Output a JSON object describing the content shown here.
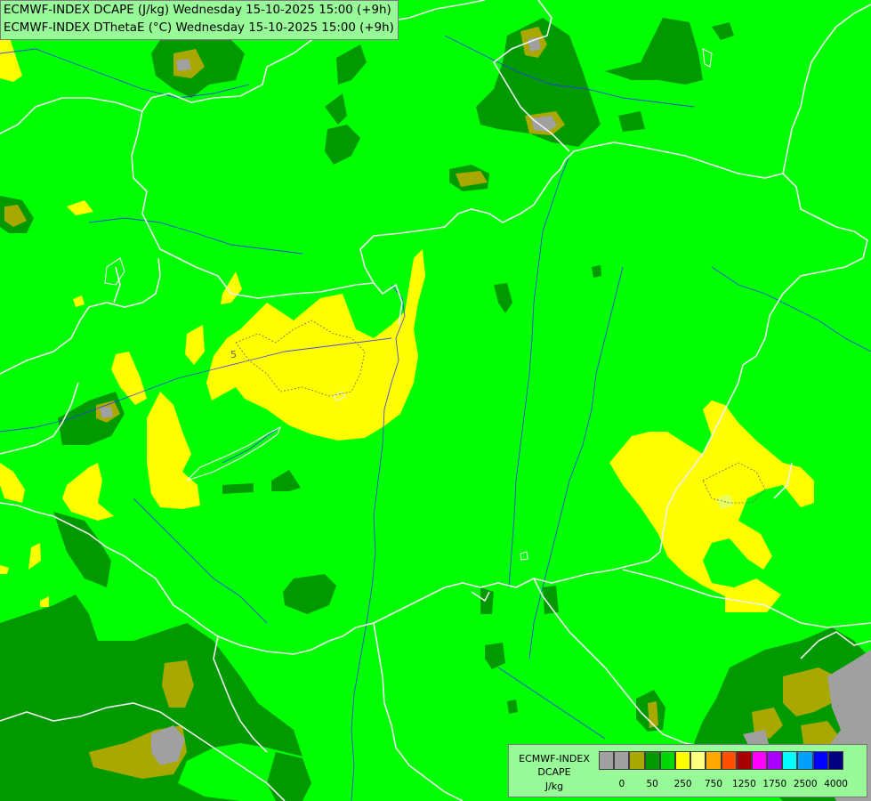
{
  "title": {
    "line1": "ECMWF-INDEX DCAPE (J/kg) Wednesday 15-10-2025 15:00 (+9h)",
    "line2": "ECMWF-INDEX DThetaE (°C) Wednesday 15-10-2025 15:00 (+9h)"
  },
  "map": {
    "contour_label": "5",
    "palette": {
      "grey": "#a0a0a0",
      "olive": "#a8a800",
      "dark_green": "#009a00",
      "green": "#00ff00",
      "yellow": "#ffff00",
      "pale_yellow": "#ffff80",
      "border": "#ffffff",
      "river": "#3030ff"
    }
  },
  "legend": {
    "product": "ECMWF-INDEX",
    "variable": "DCAPE",
    "unit": "J/kg",
    "colors": [
      "#a0a0a0",
      "#a0a0a0",
      "#a8a800",
      "#009a00",
      "#00d800",
      "#ffff00",
      "#ffff80",
      "#ffa800",
      "#ff5000",
      "#a80000",
      "#ff00ff",
      "#a800ff",
      "#00ffff",
      "#00a0ff",
      "#0000ff",
      "#000080"
    ],
    "ticks": [
      "0",
      "50",
      "250",
      "750",
      "1250",
      "1750",
      "2500",
      "4000"
    ]
  }
}
